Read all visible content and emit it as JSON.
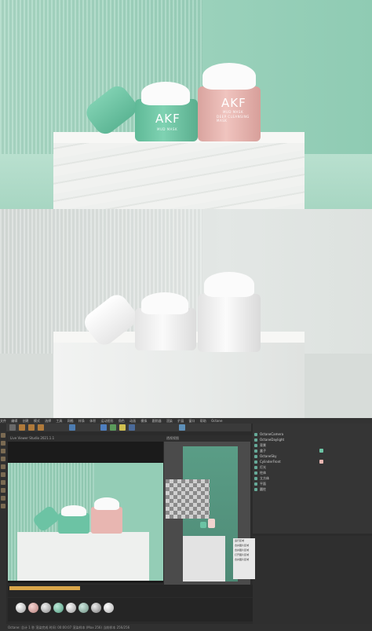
{
  "render_green": {
    "brand_left": "AKF",
    "brand_right": "AKF",
    "product_name": "MUD MASK",
    "product_sub": "DEEP CLEANSING MASK"
  },
  "render_white": {},
  "c4d": {
    "menu_items": [
      "文件",
      "编辑",
      "创建",
      "模式",
      "选择",
      "工具",
      "网格",
      "样条",
      "体积",
      "运动图形",
      "角色",
      "动画",
      "模拟",
      "跟踪器",
      "渲染",
      "扩展",
      "窗口",
      "帮助",
      "Octane"
    ],
    "viewport_label": "Live Viewer Studio 2021.1.1",
    "side_label": "透视视图",
    "objects": [
      "OctaneCamera",
      "OctaneDaylight",
      "背景",
      "盒子",
      "OctaneSky",
      "CylinderFront",
      "灯光",
      "柱体",
      "立方体",
      "平面",
      "圆柱"
    ],
    "context_menu": [
      "运行区域",
      "合并图片区域",
      "合并图片区域",
      "打开图片区域",
      "合并图片区域"
    ],
    "status": "Octane: 总计 1 秒 渲染完成 时间: 00:00:07 渲染样本 (Max 256) 当前样本 256/256"
  },
  "colors": {
    "jar_green": "#6cc3a4",
    "jar_pink": "#e8b6b1",
    "bg_green": "#9ad1bb",
    "bg_white": "#dde2df"
  }
}
